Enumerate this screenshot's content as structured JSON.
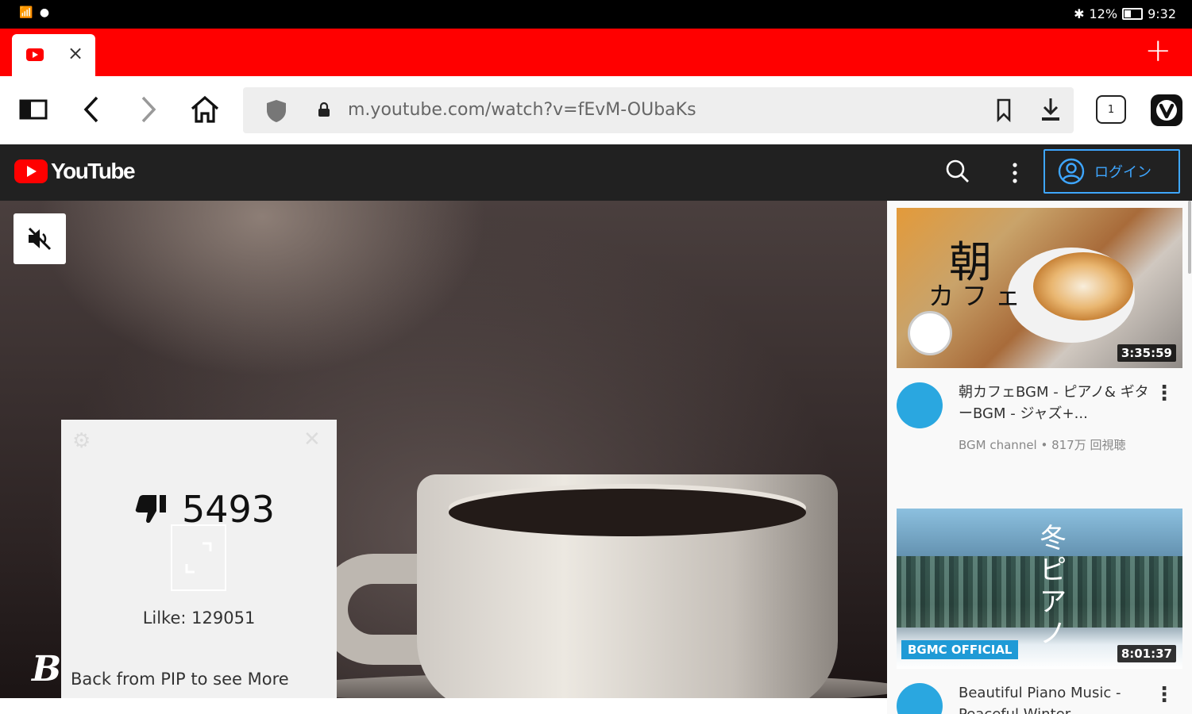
{
  "status_bar": {
    "time": "9:32",
    "battery": "12%"
  },
  "tab": {
    "close_symbol": "×"
  },
  "new_tab_symbol": "+",
  "address_bar": {
    "url": "m.youtube.com/watch?v=fEvM-OUbaKs",
    "tab_count": "1"
  },
  "youtube": {
    "logo_text": "YouTube",
    "login_label": "ログイン"
  },
  "overlay": {
    "dislike_count": "5493",
    "like_text": "Lilke: 129051",
    "pip_message": "Back from PIP to see More",
    "watermark": "B"
  },
  "sidebar": {
    "videos": [
      {
        "title": "朝カフェBGM - ピアノ& ギターBGM - ジャズ+...",
        "meta": "BGM channel • 817万 回視聴",
        "duration": "3:35:59",
        "thumb_text_1": "朝",
        "thumb_text_2": "カフェ"
      },
      {
        "title": "Beautiful Piano Music - Peaceful Winter",
        "duration": "8:01:37",
        "thumb_text_1": "冬ピアノ",
        "thumb_badge": "BGMC OFFICIAL"
      }
    ]
  },
  "colors": {
    "brand_red": "#ff0000",
    "link_blue": "#3ea6ff",
    "header_dark": "#212121"
  }
}
